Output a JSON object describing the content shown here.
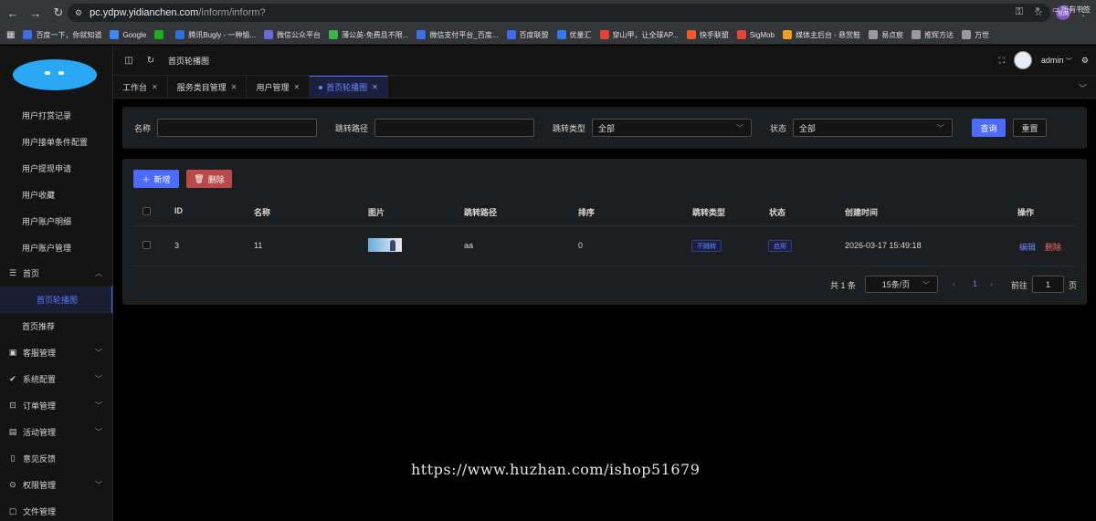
{
  "browser": {
    "url_host": "pc.ydpw.yidianchen.com",
    "url_path": "/inform/inform?",
    "profile_label": "东网"
  },
  "bookmarks": [
    {
      "label": "百度一下，你就知道",
      "color": "#3b6ee8"
    },
    {
      "label": "Google",
      "color": "#4285f4"
    },
    {
      "label": "",
      "color": "#1aad19"
    },
    {
      "label": "腾讯Bugly - 一种愉...",
      "color": "#2a72d6"
    },
    {
      "label": "微信公众平台",
      "color": "#6b6bd8"
    },
    {
      "label": "薄公英-免费且不限...",
      "color": "#39b54a"
    },
    {
      "label": "微信支付平台_百度...",
      "color": "#3b6ee8"
    },
    {
      "label": "百度联盟",
      "color": "#3b6ee8"
    },
    {
      "label": "优量汇",
      "color": "#2f7cf6"
    },
    {
      "label": "穿山甲，让全球AP...",
      "color": "#e8413a"
    },
    {
      "label": "快手联盟",
      "color": "#f25a2a"
    },
    {
      "label": "SigMob",
      "color": "#e8413a"
    },
    {
      "label": "媒体主后台 - 悬赏鞋",
      "color": "#f0a020"
    },
    {
      "label": "易点宸",
      "color": "#9a9a9a"
    },
    {
      "label": "推辉方达",
      "color": "#9a9a9a"
    },
    {
      "label": "万世",
      "color": "#9a9a9a"
    }
  ],
  "bookmarks_more": "»",
  "bookmarks_all": "所有书签",
  "sidebar": {
    "items": [
      {
        "label": "用户打赏记录"
      },
      {
        "label": "用户接单条件配置"
      },
      {
        "label": "用户提现申请"
      },
      {
        "label": "用户收藏"
      },
      {
        "label": "用户账户明细"
      },
      {
        "label": "用户账户管理"
      }
    ],
    "home_group": "首页",
    "home_active": "首页轮播图",
    "home_recommend": "首页推荐",
    "groups": [
      {
        "label": "客服管理",
        "icon": "chat-icon"
      },
      {
        "label": "系统配置",
        "icon": "check-circle-icon"
      },
      {
        "label": "订单管理",
        "icon": "cart-icon"
      },
      {
        "label": "活动管理",
        "icon": "calendar-icon"
      },
      {
        "label": "意见反馈",
        "icon": "document-icon"
      },
      {
        "label": "权限管理",
        "icon": "lock-icon"
      },
      {
        "label": "文件管理",
        "icon": "folder-icon"
      }
    ]
  },
  "header": {
    "breadcrumb": "首页轮播图",
    "username": "admin"
  },
  "tabs": [
    {
      "label": "工作台"
    },
    {
      "label": "服务类目管理"
    },
    {
      "label": "用户管理"
    },
    {
      "label": "首页轮播图"
    }
  ],
  "filter": {
    "name_label": "名称",
    "path_label": "跳转路径",
    "type_label": "跳转类型",
    "type_value": "全部",
    "status_label": "状态",
    "status_value": "全部",
    "search_label": "查询",
    "reset_label": "重置"
  },
  "toolbar": {
    "add_label": "新增",
    "delete_label": "删除"
  },
  "table": {
    "headers": [
      "ID",
      "名称",
      "图片",
      "跳转路径",
      "排序",
      "跳转类型",
      "状态",
      "创建时间",
      "操作"
    ],
    "rows": [
      {
        "id": "3",
        "name": "11",
        "path": "aa",
        "sort": "0",
        "jump_type": "不跳转",
        "status": "启用",
        "created": "2026-03-17 15:49:18",
        "edit": "编辑",
        "delete": "删除"
      }
    ]
  },
  "pagination": {
    "total": "共 1 条",
    "page_size": "15条/页",
    "current_page": "1",
    "goto_label": "前往",
    "goto_value": "1",
    "page_unit": "页"
  },
  "watermark": "https://www.huzhan.com/ishop51679",
  "colors": {
    "accent": "#4d6bfe",
    "danger": "#b94a4a",
    "danger_text": "#f56c6c"
  }
}
